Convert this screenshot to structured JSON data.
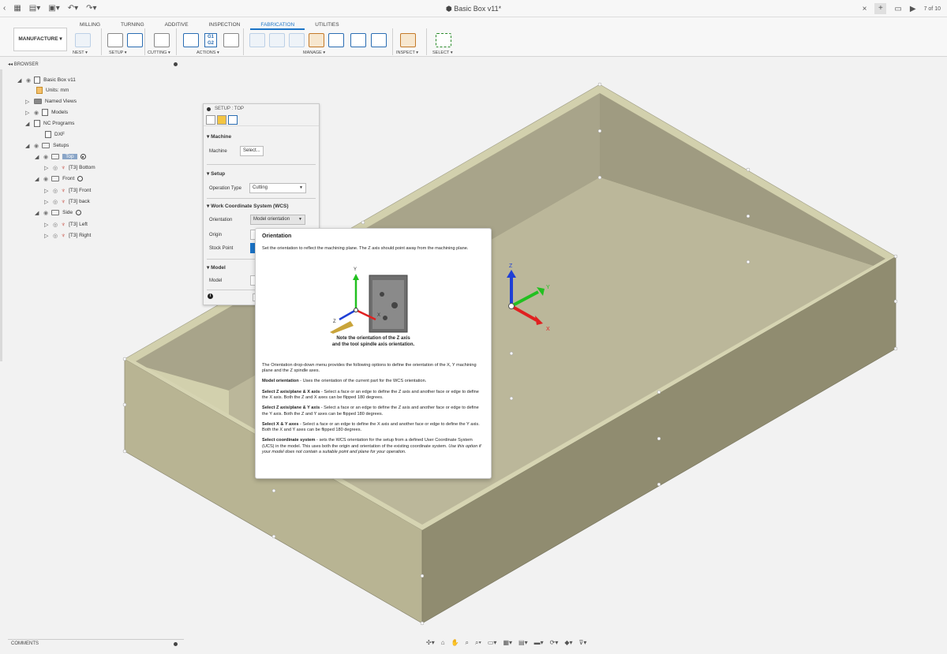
{
  "window": {
    "title": "Basic Box v11*",
    "page_count": "7 of 10"
  },
  "ribbon": {
    "workspace": "MANUFACTURE",
    "tabs": [
      "MILLING",
      "TURNING",
      "ADDITIVE",
      "INSPECTION",
      "FABRICATION",
      "UTILITIES"
    ],
    "active_tab": "FABRICATION",
    "groups": [
      "NEST",
      "SETUP",
      "CUTTING",
      "ACTIONS",
      "MANAGE",
      "INSPECT",
      "SELECT"
    ],
    "g1g2_label": "G1 G2"
  },
  "browser": {
    "header": "BROWSER",
    "items": [
      {
        "label": "Basic Box v11"
      },
      {
        "label": "Units: mm"
      },
      {
        "label": "Named Views"
      },
      {
        "label": "Models"
      },
      {
        "label": "NC Programs"
      },
      {
        "label": "DXF"
      },
      {
        "label": "Setups"
      },
      {
        "label": "Top"
      },
      {
        "label": "[T3] Bottom"
      },
      {
        "label": "Front"
      },
      {
        "label": "[T3] Front"
      },
      {
        "label": "[T3] back"
      },
      {
        "label": "Side"
      },
      {
        "label": "[T3] Left"
      },
      {
        "label": "[T3] Right"
      }
    ]
  },
  "setup_panel": {
    "title": "SETUP : TOP",
    "machine_section": "Machine",
    "machine_label": "Machine",
    "machine_button": "Select...",
    "setup_section": "Setup",
    "operation_type_label": "Operation Type",
    "operation_type_value": "Cutting",
    "wcs_section": "Work Coordinate System (WCS)",
    "orientation_label": "Orientation",
    "orientation_value": "Model orientation",
    "origin_label": "Origin",
    "stock_point_label": "Stock Point",
    "model_section": "Model",
    "model_label": "Model"
  },
  "tooltip": {
    "title": "Orientation",
    "intro": "Set the orientation to reflect the machining plane. The Z axis should point away from the machining plane.",
    "caption_line1": "Note the orientation of the Z axis",
    "caption_line2": "and the tool spindle axis orientation.",
    "description": "The Orientation drop-down menu provides the following options to define the orientation of the X, Y machining plane and the Z spindle axes.",
    "options": [
      {
        "name": "Model orientation",
        "text": " - Uses the orientation of the current part for the WCS orientation."
      },
      {
        "name": "Select Z axis/plane & X axis",
        "text": " - Select a face or an edge to define the Z axis and another face or edge to define the X axis. Both the Z and X axes can be flipped 180 degrees."
      },
      {
        "name": "Select Z axis/plane & Y axis",
        "text": " - Select a face or an edge to define the Z axis and another face or edge to define the Y axis. Both the Z and Y axes can be flipped 180 degrees."
      },
      {
        "name": "Select X & Y axes",
        "text": " - Select a face or an edge to define the X axis and another face or edge to define the Y axis. Both the X and Y axes can be flipped 180 degrees."
      },
      {
        "name": "Select coordinate system",
        "text": " - sets the WCS orientation for the setup from a defined User Coordinate System (UCS) in the model. This uses both the origin and orientation of the existing coordinate system. ",
        "italic": "Use this option if your model does not contain a suitable point and plane for your operation."
      }
    ],
    "axes": {
      "x": "X",
      "y": "Y",
      "z": "Z"
    }
  },
  "viewport": {
    "triad": {
      "x": "X",
      "y": "Y",
      "z": "Z"
    },
    "colors": {
      "box_face": "#b9b596",
      "box_side": "#918d71",
      "box_top": "#d2d0ad"
    }
  },
  "comments": {
    "label": "COMMENTS"
  }
}
